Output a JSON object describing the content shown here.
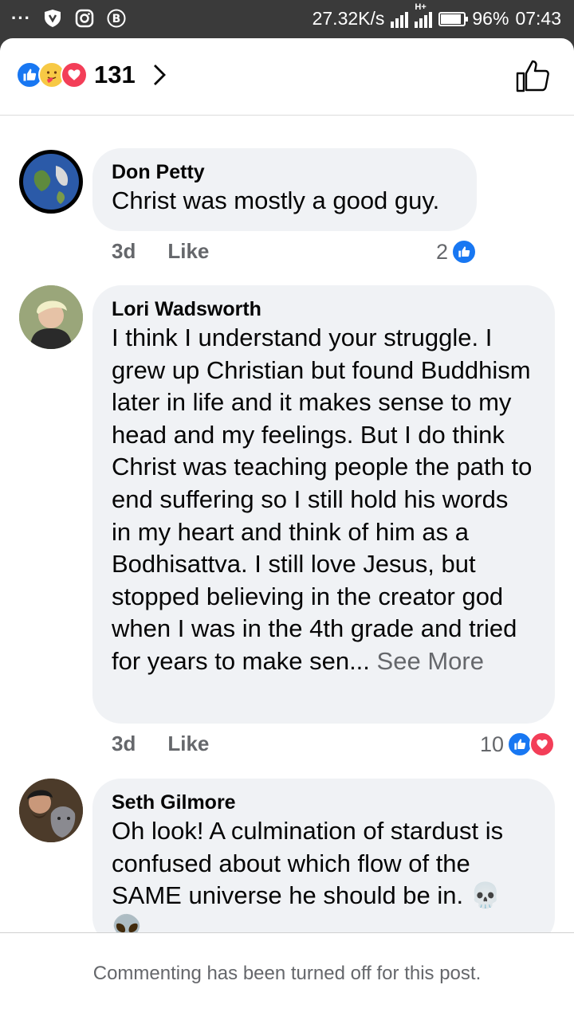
{
  "status_bar": {
    "speed": "27.32K/s",
    "network": "H+",
    "battery": "96%",
    "battery_level": 0.96,
    "time": "07:43"
  },
  "header": {
    "reaction_count": "131",
    "reactions": [
      "like",
      "care",
      "love"
    ]
  },
  "comments": [
    {
      "author": "Don Petty",
      "text": "Christ was mostly a good guy.",
      "age": "3d",
      "like_label": "Like",
      "reaction_count": "2",
      "reactions": [
        "like"
      ]
    },
    {
      "author": "Lori Wadsworth",
      "text": "I think I understand your struggle. I grew up Christian but found Buddhism later in life and it makes sense to my head and my feelings. But I do think Christ was teaching people the path to end suffering so I still hold his words in my heart and think of him as a Bodhisattva. I still love  Jesus, but stopped believing in the creator god when I was in the 4th grade and tried for years to make sen...",
      "see_more": "See More",
      "age": "3d",
      "like_label": "Like",
      "reaction_count": "10",
      "reactions": [
        "like",
        "love"
      ]
    },
    {
      "author": "Seth Gilmore",
      "text": "Oh look! A culmination of stardust is confused about which flow of the SAME universe he should be in. 💀 👽",
      "emoji_next_line": "🤡"
    }
  ],
  "footer": {
    "notice": "Commenting has been turned off for this post."
  },
  "colors": {
    "accent": "#1877f2",
    "love": "#f33e58",
    "bubble": "#f0f2f5",
    "secondary_text": "#65676b"
  }
}
